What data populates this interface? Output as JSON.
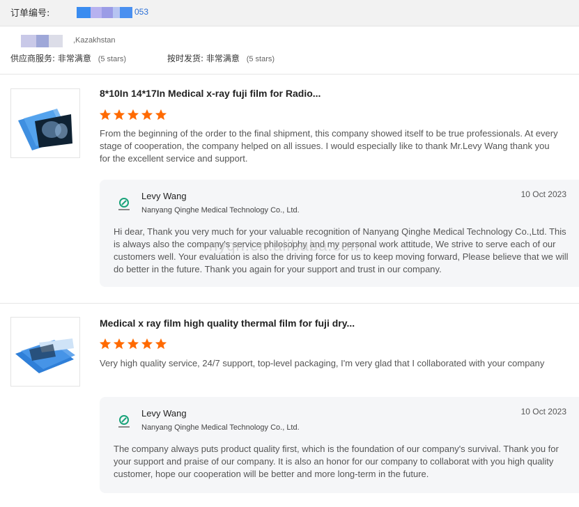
{
  "order": {
    "label": "订单编号:",
    "number_suffix": "053",
    "blur_colors": [
      "#3a8cf0",
      "#b7b2f0",
      "#9b9ce6",
      "#b6c4f2",
      "#4a90f0"
    ]
  },
  "buyer": {
    "country": ",Kazakhstan",
    "blur_colors": [
      "#c9c9e8",
      "#9ea7d8",
      "#dcdde8"
    ]
  },
  "ratings": [
    {
      "label": "供应商服务:",
      "value": "非常满意",
      "note": "(5 stars)"
    },
    {
      "label": "按时发货:",
      "value": "非常满意",
      "note": "(5 stars)"
    }
  ],
  "reviews": [
    {
      "title": "8*10In 14*17In Medical x-ray fuji film for Radio...",
      "stars": 5,
      "text": "From the beginning of the order to the final shipment, this company showed itself to be true professionals. At every stage of cooperation, the company helped on all issues. I would especially like to thank Mr.Levy Wang thank you for the excellent service and support.",
      "reply": {
        "name": "Levy Wang",
        "company": "Nanyang Qinghe Medical Technology Co., Ltd.",
        "date": "10 Oct 2023",
        "text": "Hi dear, Thank you very much for your valuable recognition of Nanyang Qinghe Medical Technology Co.,Ltd. This is always also the company's service philosophy and my personal work attitude, We strive to serve each of our customers well. Your evaluation is also the driving force for us to keep moving forward, Please believe that we will do better in the future. Thank you again for your support and trust in our company."
      }
    },
    {
      "title": "Medical x ray film high quality thermal film for fuji dry...",
      "stars": 5,
      "text": "Very high quality service, 24/7 support, top-level packaging, I'm very glad that I collaborated with your company",
      "reply": {
        "name": "Levy Wang",
        "company": "Nanyang Qinghe Medical Technology Co., Ltd.",
        "date": "10 Oct 2023",
        "text": "The company always puts product quality first, which is the foundation of our company's survival. Thank you for your support and praise of our company. It is also an honor for our company to collaborat with you high quality customer, hope our cooperation will be better and more long-term in the future."
      }
    }
  ],
  "watermark": "nyqn.en.alibaba.com",
  "colors": {
    "star": "#ff6a00",
    "link": "#2a6fd6",
    "reply_bg": "#f5f6f8",
    "logo_green": "#1aa37a"
  }
}
